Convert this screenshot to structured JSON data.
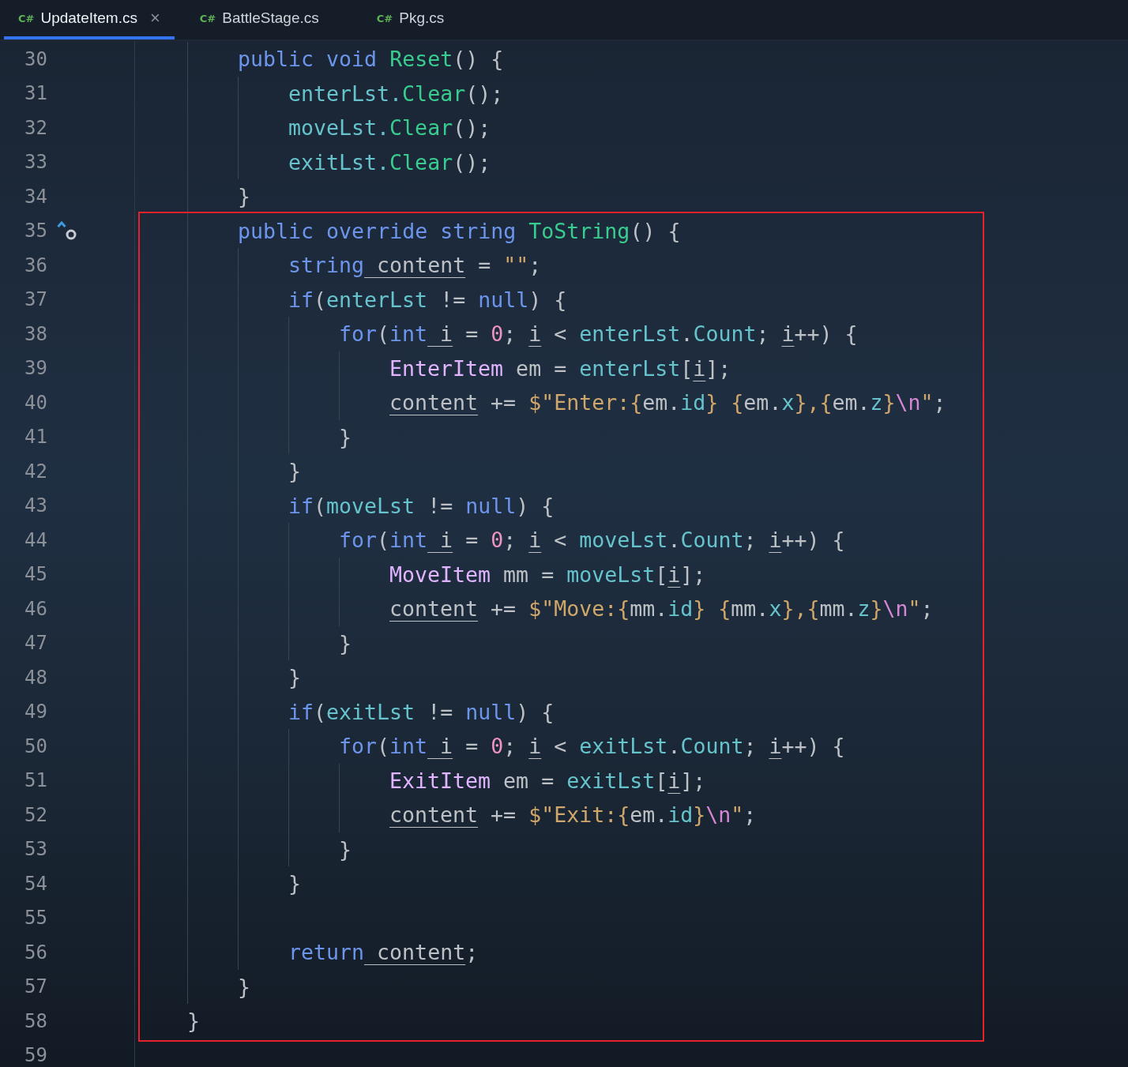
{
  "tabs": [
    {
      "icon_text": "C#",
      "label": "UpdateItem.cs",
      "selected": true,
      "close": "×"
    },
    {
      "icon_text": "C#",
      "label": "BattleStage.cs",
      "selected": false
    },
    {
      "icon_text": "C#",
      "label": "Pkg.cs",
      "selected": false
    }
  ],
  "editor": {
    "lines_before": [
      {
        "number": "30",
        "tokens": [
          {
            "kind": "keyword",
            "text": "        public"
          },
          {
            "kind": "keyword",
            "text": " void"
          },
          {
            "kind": "method",
            "text": " Reset"
          },
          {
            "kind": "plain",
            "text": "() {"
          }
        ]
      },
      {
        "number": "31",
        "tokens": [
          {
            "kind": "field",
            "text": "            enterLst."
          },
          {
            "kind": "method",
            "text": "Clear"
          },
          {
            "kind": "plain",
            "text": "();"
          }
        ]
      },
      {
        "number": "32",
        "tokens": [
          {
            "kind": "field",
            "text": "            moveLst."
          },
          {
            "kind": "method",
            "text": "Clear"
          },
          {
            "kind": "plain",
            "text": "();"
          }
        ]
      },
      {
        "number": "33",
        "tokens": [
          {
            "kind": "field",
            "text": "            exitLst."
          },
          {
            "kind": "method",
            "text": "Clear"
          },
          {
            "kind": "plain",
            "text": "();"
          }
        ]
      },
      {
        "number": "34",
        "tokens": [
          {
            "kind": "plain",
            "text": "        }"
          }
        ]
      }
    ],
    "highlight_box": {
      "lines": [
        {
          "number": "35",
          "gutter_marks": [
            {
              "kind": "override"
            }
          ],
          "tokens": [
            {
              "kind": "keyword",
              "text": "        public"
            },
            {
              "kind": "keyword",
              "text": " override"
            },
            {
              "kind": "keyword",
              "text": " string"
            },
            {
              "kind": "method",
              "text": " ToString"
            },
            {
              "kind": "plain",
              "text": "() {"
            }
          ]
        },
        {
          "number": "36",
          "tokens": [
            {
              "kind": "keyword",
              "text": "            string"
            },
            {
              "kind": "local",
              "text": " content"
            },
            {
              "kind": "plain",
              "text": " = "
            },
            {
              "kind": "string",
              "text": "\"\""
            },
            {
              "kind": "plain",
              "text": ";"
            }
          ]
        },
        {
          "number": "37",
          "tokens": [
            {
              "kind": "keyword",
              "text": "            if"
            },
            {
              "kind": "plain",
              "text": "("
            },
            {
              "kind": "field",
              "text": "enterLst"
            },
            {
              "kind": "plain",
              "text": " != "
            },
            {
              "kind": "keyword",
              "text": "null"
            },
            {
              "kind": "plain",
              "text": ") {"
            }
          ]
        },
        {
          "number": "38",
          "tokens": [
            {
              "kind": "keyword",
              "text": "                for"
            },
            {
              "kind": "plain",
              "text": "("
            },
            {
              "kind": "keyword",
              "text": "int"
            },
            {
              "kind": "local",
              "text": " i"
            },
            {
              "kind": "plain",
              "text": " = "
            },
            {
              "kind": "number",
              "text": "0"
            },
            {
              "kind": "plain",
              "text": "; "
            },
            {
              "kind": "local",
              "text": "i"
            },
            {
              "kind": "plain",
              "text": " < "
            },
            {
              "kind": "field",
              "text": "enterLst"
            },
            {
              "kind": "plain",
              "text": "."
            },
            {
              "kind": "field",
              "text": "Count"
            },
            {
              "kind": "plain",
              "text": "; "
            },
            {
              "kind": "local",
              "text": "i"
            },
            {
              "kind": "plain",
              "text": "++) {"
            }
          ]
        },
        {
          "number": "39",
          "tokens": [
            {
              "kind": "type",
              "text": "                    EnterItem"
            },
            {
              "kind": "plain",
              "text": " em = "
            },
            {
              "kind": "field",
              "text": "enterLst"
            },
            {
              "kind": "plain",
              "text": "["
            },
            {
              "kind": "local",
              "text": "i"
            },
            {
              "kind": "plain",
              "text": "];"
            }
          ]
        },
        {
          "number": "40",
          "tokens": [
            {
              "kind": "local",
              "text": "                    content"
            },
            {
              "kind": "plain",
              "text": " += "
            },
            {
              "kind": "string",
              "text": "$\"Enter:{"
            },
            {
              "kind": "plain",
              "text": "em."
            },
            {
              "kind": "field",
              "text": "id"
            },
            {
              "kind": "string",
              "text": "} {"
            },
            {
              "kind": "plain",
              "text": "em."
            },
            {
              "kind": "field",
              "text": "x"
            },
            {
              "kind": "string",
              "text": "},{"
            },
            {
              "kind": "plain",
              "text": "em."
            },
            {
              "kind": "field",
              "text": "z"
            },
            {
              "kind": "string",
              "text": "}"
            },
            {
              "kind": "escape",
              "text": "\\n"
            },
            {
              "kind": "string",
              "text": "\""
            },
            {
              "kind": "plain",
              "text": ";"
            }
          ]
        },
        {
          "number": "41",
          "tokens": [
            {
              "kind": "plain",
              "text": "                }"
            }
          ]
        },
        {
          "number": "42",
          "tokens": [
            {
              "kind": "plain",
              "text": "            }"
            }
          ]
        },
        {
          "number": "43",
          "tokens": [
            {
              "kind": "keyword",
              "text": "            if"
            },
            {
              "kind": "plain",
              "text": "("
            },
            {
              "kind": "field",
              "text": "moveLst"
            },
            {
              "kind": "plain",
              "text": " != "
            },
            {
              "kind": "keyword",
              "text": "null"
            },
            {
              "kind": "plain",
              "text": ") {"
            }
          ]
        },
        {
          "number": "44",
          "tokens": [
            {
              "kind": "keyword",
              "text": "                for"
            },
            {
              "kind": "plain",
              "text": "("
            },
            {
              "kind": "keyword",
              "text": "int"
            },
            {
              "kind": "local",
              "text": " i"
            },
            {
              "kind": "plain",
              "text": " = "
            },
            {
              "kind": "number",
              "text": "0"
            },
            {
              "kind": "plain",
              "text": "; "
            },
            {
              "kind": "local",
              "text": "i"
            },
            {
              "kind": "plain",
              "text": " < "
            },
            {
              "kind": "field",
              "text": "moveLst"
            },
            {
              "kind": "plain",
              "text": "."
            },
            {
              "kind": "field",
              "text": "Count"
            },
            {
              "kind": "plain",
              "text": "; "
            },
            {
              "kind": "local",
              "text": "i"
            },
            {
              "kind": "plain",
              "text": "++) {"
            }
          ]
        },
        {
          "number": "45",
          "tokens": [
            {
              "kind": "type",
              "text": "                    MoveItem"
            },
            {
              "kind": "plain",
              "text": " mm = "
            },
            {
              "kind": "field",
              "text": "moveLst"
            },
            {
              "kind": "plain",
              "text": "["
            },
            {
              "kind": "local",
              "text": "i"
            },
            {
              "kind": "plain",
              "text": "];"
            }
          ]
        },
        {
          "number": "46",
          "tokens": [
            {
              "kind": "local",
              "text": "                    content"
            },
            {
              "kind": "plain",
              "text": " += "
            },
            {
              "kind": "string",
              "text": "$\"Move:{"
            },
            {
              "kind": "plain",
              "text": "mm."
            },
            {
              "kind": "field",
              "text": "id"
            },
            {
              "kind": "string",
              "text": "} {"
            },
            {
              "kind": "plain",
              "text": "mm."
            },
            {
              "kind": "field",
              "text": "x"
            },
            {
              "kind": "string",
              "text": "},{"
            },
            {
              "kind": "plain",
              "text": "mm."
            },
            {
              "kind": "field",
              "text": "z"
            },
            {
              "kind": "string",
              "text": "}"
            },
            {
              "kind": "escape",
              "text": "\\n"
            },
            {
              "kind": "string",
              "text": "\""
            },
            {
              "kind": "plain",
              "text": ";"
            }
          ]
        },
        {
          "number": "47",
          "tokens": [
            {
              "kind": "plain",
              "text": "                }"
            }
          ]
        },
        {
          "number": "48",
          "tokens": [
            {
              "kind": "plain",
              "text": "            }"
            }
          ]
        },
        {
          "number": "49",
          "tokens": [
            {
              "kind": "keyword",
              "text": "            if"
            },
            {
              "kind": "plain",
              "text": "("
            },
            {
              "kind": "field",
              "text": "exitLst"
            },
            {
              "kind": "plain",
              "text": " != "
            },
            {
              "kind": "keyword",
              "text": "null"
            },
            {
              "kind": "plain",
              "text": ") {"
            }
          ]
        },
        {
          "number": "50",
          "tokens": [
            {
              "kind": "keyword",
              "text": "                for"
            },
            {
              "kind": "plain",
              "text": "("
            },
            {
              "kind": "keyword",
              "text": "int"
            },
            {
              "kind": "local",
              "text": " i"
            },
            {
              "kind": "plain",
              "text": " = "
            },
            {
              "kind": "number",
              "text": "0"
            },
            {
              "kind": "plain",
              "text": "; "
            },
            {
              "kind": "local",
              "text": "i"
            },
            {
              "kind": "plain",
              "text": " < "
            },
            {
              "kind": "field",
              "text": "exitLst"
            },
            {
              "kind": "plain",
              "text": "."
            },
            {
              "kind": "field",
              "text": "Count"
            },
            {
              "kind": "plain",
              "text": "; "
            },
            {
              "kind": "local",
              "text": "i"
            },
            {
              "kind": "plain",
              "text": "++) {"
            }
          ]
        },
        {
          "number": "51",
          "tokens": [
            {
              "kind": "type",
              "text": "                    ExitItem"
            },
            {
              "kind": "plain",
              "text": " em = "
            },
            {
              "kind": "field",
              "text": "exitLst"
            },
            {
              "kind": "plain",
              "text": "["
            },
            {
              "kind": "local",
              "text": "i"
            },
            {
              "kind": "plain",
              "text": "];"
            }
          ]
        },
        {
          "number": "52",
          "tokens": [
            {
              "kind": "local",
              "text": "                    content"
            },
            {
              "kind": "plain",
              "text": " += "
            },
            {
              "kind": "string",
              "text": "$\"Exit:{"
            },
            {
              "kind": "plain",
              "text": "em."
            },
            {
              "kind": "field",
              "text": "id"
            },
            {
              "kind": "string",
              "text": "}"
            },
            {
              "kind": "escape",
              "text": "\\n"
            },
            {
              "kind": "string",
              "text": "\""
            },
            {
              "kind": "plain",
              "text": ";"
            }
          ]
        },
        {
          "number": "53",
          "tokens": [
            {
              "kind": "plain",
              "text": "                }"
            }
          ]
        },
        {
          "number": "54",
          "tokens": [
            {
              "kind": "plain",
              "text": "            }"
            }
          ]
        },
        {
          "number": "55"
        },
        {
          "number": "56",
          "tokens": [
            {
              "kind": "keyword",
              "text": "            return"
            },
            {
              "kind": "local",
              "text": " content"
            },
            {
              "kind": "plain",
              "text": ";"
            }
          ]
        },
        {
          "number": "57",
          "tokens": [
            {
              "kind": "plain",
              "text": "        }"
            }
          ]
        },
        {
          "number": "58",
          "tokens": [
            {
              "kind": "plain",
              "text": "    }"
            }
          ]
        }
      ]
    },
    "lines_after": [
      {
        "number": "59"
      }
    ]
  }
}
